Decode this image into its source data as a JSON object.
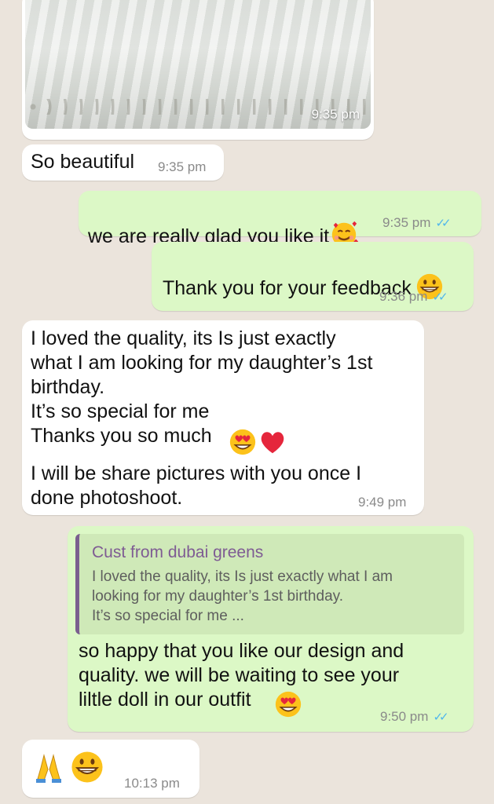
{
  "messages": {
    "photo": {
      "time": "9:35 pm"
    },
    "m1": {
      "text": "So beautiful",
      "time": "9:35 pm"
    },
    "m2": {
      "text": "we are really glad you like it",
      "time": "9:35 pm",
      "emoji": "smiling-face-with-hearts"
    },
    "m3": {
      "text": "Thank you for your feedback",
      "time": "9:36 pm",
      "emoji": "grinning-face"
    },
    "m4": {
      "text": "I loved the quality, its Is just exactly\nwhat I am looking for my daughter’s 1st\nbirthday.\nIt’s so special for me\nThanks you so much",
      "text2": "I will be share pictures with you once I\ndone photoshoot.",
      "time": "9:49 pm",
      "emojis": [
        "heart-eyes-face",
        "red-heart"
      ]
    },
    "m5": {
      "quote_name": "Cust from dubai greens",
      "quote_text": "I loved the quality, its Is just exactly what I am\nlooking for my daughter’s 1st birthday.\nIt’s so special for me ...",
      "text": "so happy that you like our design and\nquality. we will be waiting to see your\nliltle doll in our outfit",
      "time": "9:50 pm",
      "emoji": "heart-eyes-face"
    },
    "m6": {
      "time": "10:13 pm",
      "emojis": [
        "folded-hands",
        "grinning-face"
      ]
    }
  },
  "colors": {
    "incoming": "#ffffff",
    "outgoing": "#dcf8c6",
    "read_ticks": "#4fb6ec",
    "quote_author": "#7e5b93"
  }
}
